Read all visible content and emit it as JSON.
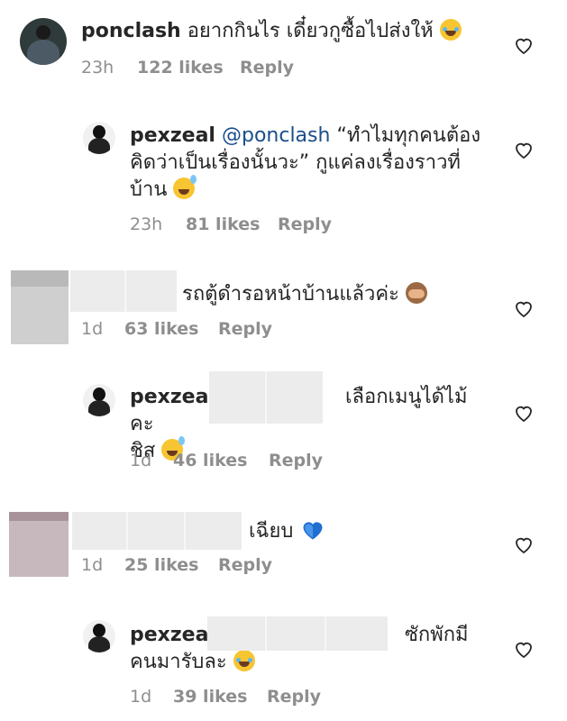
{
  "comments": [
    {
      "username": "ponclash",
      "mention": "",
      "text": "อยากกินไร เดี๋ยวกูซื้อไปส่งให้",
      "time": "23h",
      "likes": "122 likes",
      "reply": "Reply",
      "emoji": "face-with-tears-of-joy"
    },
    {
      "username": "pexzeal",
      "mention": "@ponclash",
      "text_line1": "“ทำไมทุกคนต้อง",
      "text_line2": "คิดว่าเป็นเรื่องนั้นวะ” กูแค่ลงเรื่องราวที่",
      "text_line3": "บ้าน",
      "time": "23h",
      "likes": "81 likes",
      "reply": "Reply",
      "emoji": "grinning-face-with-sweat"
    },
    {
      "username": "",
      "text": "รถตู้ดำรอหน้าบ้านแล้วค่ะ",
      "time": "1d",
      "likes": "63 likes",
      "reply": "Reply",
      "emoji": "see-no-evil-monkey"
    },
    {
      "username": "pexzeal",
      "text_line1": "เลือกเมนูได้ไม้คะ",
      "text_line2": "ชิส",
      "time": "1d",
      "likes": "46 likes",
      "reply": "Reply",
      "emoji": "grinning-face-with-sweat"
    },
    {
      "username": "",
      "text": "เฉียบ",
      "time": "1d",
      "likes": "25 likes",
      "reply": "Reply",
      "emoji": "blue-heart"
    },
    {
      "username": "pexzeal",
      "text_line1": "ซักพักมี",
      "text_line2": "คนมารับละ",
      "time": "1d",
      "likes": "39 likes",
      "reply": "Reply",
      "emoji": "face-with-tears-of-joy"
    }
  ],
  "icons": {
    "like": "heart-outline-icon"
  },
  "colors": {
    "text": "#262626",
    "meta": "#8e8e8e",
    "mention": "#1a4e8a",
    "heart": "#262626"
  }
}
